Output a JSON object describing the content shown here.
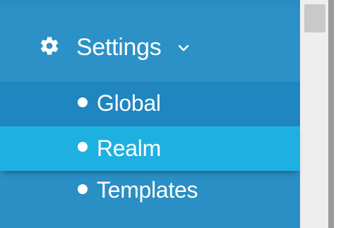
{
  "sidebar": {
    "settings": {
      "label": "Settings",
      "icon": "gear-icon",
      "expand_icon": "chevron-down-icon"
    },
    "items": [
      {
        "label": "Global",
        "icon": "bullet-icon"
      },
      {
        "label": "Realm",
        "icon": "bullet-icon",
        "active": true
      },
      {
        "label": "Templates",
        "icon": "bullet-icon"
      }
    ]
  },
  "colors": {
    "sidebar_bg": "#2a8fc4",
    "submenu_bg": "#1f86bf",
    "active_bg": "#1fb0e2",
    "text": "#ffffff",
    "scrollbar_track": "#eeeeee",
    "scrollbar_thumb": "#c9c9c9"
  }
}
